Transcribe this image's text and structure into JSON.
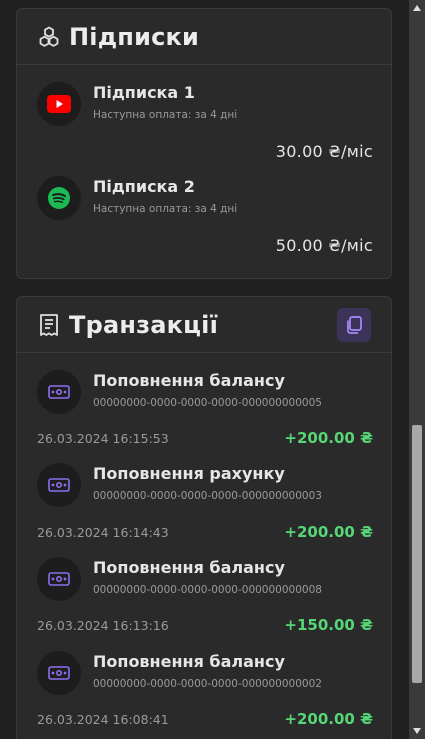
{
  "subscriptions": {
    "title": "Підписки",
    "items": [
      {
        "name": "Підписка 1",
        "next_payment": "Наступна оплата: за 4 дні",
        "price": "30.00 ₴/міс",
        "icon": "youtube-icon"
      },
      {
        "name": "Підписка 2",
        "next_payment": "Наступна оплата: за 4 дні",
        "price": "50.00 ₴/міс",
        "icon": "spotify-icon"
      }
    ]
  },
  "transactions": {
    "title": "Транзакції",
    "copy_icon": "copy-icon",
    "items": [
      {
        "title": "Поповнення балансу",
        "id": "00000000-0000-0000-0000-000000000005",
        "date": "26.03.2024 16:15:53",
        "amount": "+200.00 ₴"
      },
      {
        "title": "Поповнення рахунку",
        "id": "00000000-0000-0000-0000-000000000003",
        "date": "26.03.2024 16:14:43",
        "amount": "+200.00 ₴"
      },
      {
        "title": "Поповнення балансу",
        "id": "00000000-0000-0000-0000-000000000008",
        "date": "26.03.2024 16:13:16",
        "amount": "+150.00 ₴"
      },
      {
        "title": "Поповнення балансу",
        "id": "00000000-0000-0000-0000-000000000002",
        "date": "26.03.2024 16:08:41",
        "amount": "+200.00 ₴"
      }
    ]
  },
  "colors": {
    "background": "#202020",
    "card": "#2a2a2a",
    "accent": "#8b6ff0",
    "positive": "#56d676",
    "youtube": "#ff0000",
    "spotify": "#1db954"
  }
}
